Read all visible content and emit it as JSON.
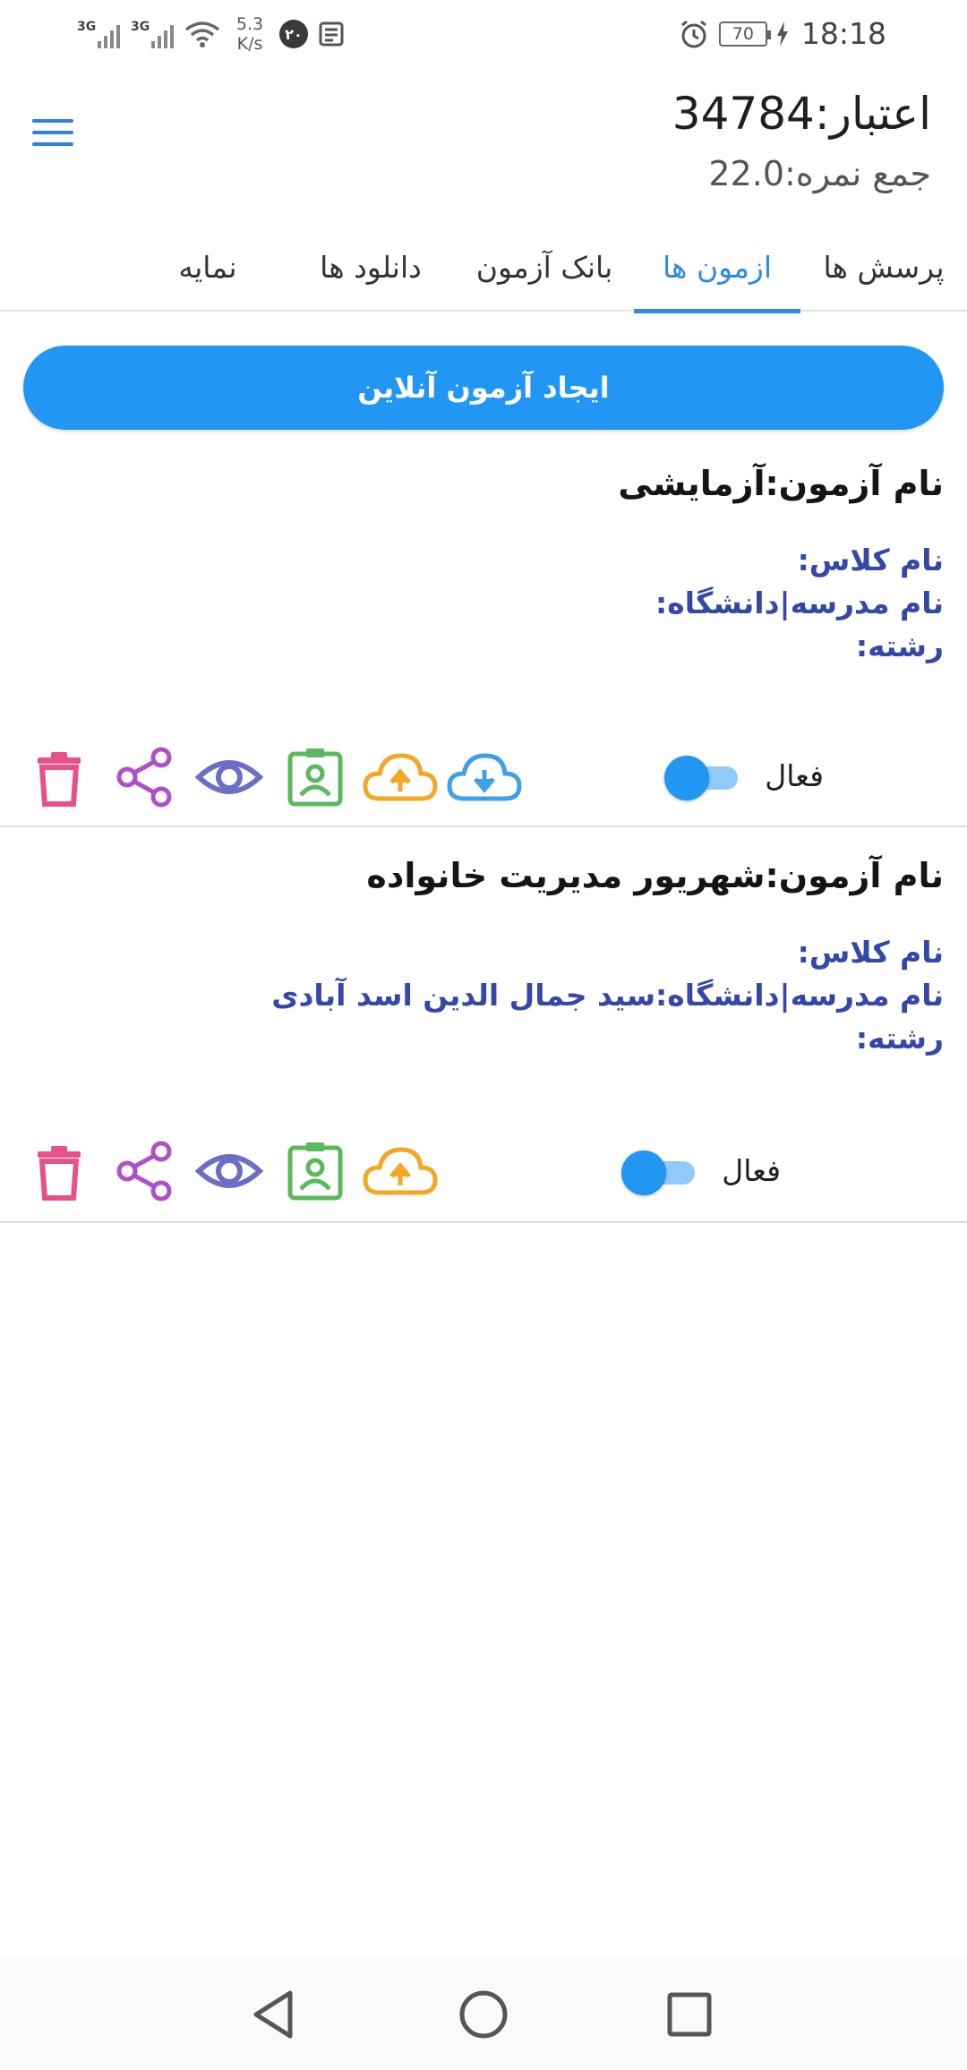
{
  "status_bar": {
    "network_1": "3G",
    "network_2": "3G",
    "speed_value": "5.3",
    "speed_unit": "K/s",
    "notification_badge": "۲۰",
    "battery": "70",
    "time": "18:18"
  },
  "header": {
    "credit": "اعتبار:34784",
    "score": "جمع نمره:22.0"
  },
  "tabs": [
    {
      "label": "پرسش ها",
      "active": false
    },
    {
      "label": "ازمون ها",
      "active": true
    },
    {
      "label": "بانک آزمون",
      "active": false
    },
    {
      "label": "دانلود ها",
      "active": false
    },
    {
      "label": "نمایه",
      "active": false
    }
  ],
  "create_button": {
    "label": "ایجاد آزمون آنلاین"
  },
  "exams": [
    {
      "title": "نام آزمون:آزمایشی",
      "class_name": "نام کلاس:",
      "school": "نام مدرسه|دانشگاه:",
      "field": "رشته:",
      "active_label": "فعال",
      "active": true
    },
    {
      "title": "نام آزمون:شهریور مدیریت خانواده",
      "class_name": "نام کلاس:",
      "school": "نام مدرسه|دانشگاه:سید جمال الدین اسد آبادی",
      "field": "رشته:",
      "active_label": "فعال",
      "active": true
    }
  ],
  "icons": {
    "delete": "delete-icon",
    "share": "share-icon",
    "view": "eye-icon",
    "students": "badge-icon",
    "upload": "cloud-upload-icon",
    "download": "cloud-download-icon"
  },
  "colors": {
    "accent": "#2196f3",
    "delete": "#e8508a",
    "share": "#b050c8",
    "view": "#6a6fc4",
    "students": "#5cb85c",
    "upload": "#f5a623",
    "download": "#3ea0e8",
    "field_text": "#3348a8"
  }
}
